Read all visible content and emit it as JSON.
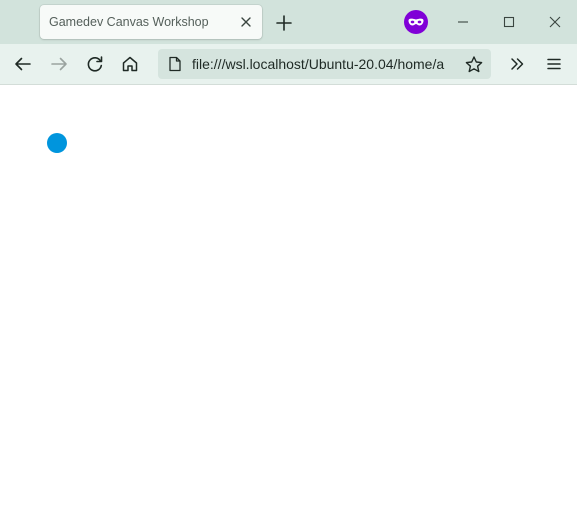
{
  "browser": {
    "tab": {
      "title": "Gamedev Canvas Workshop",
      "close_icon": "close-icon"
    },
    "new_tab_icon": "plus-icon",
    "private_browsing_icon": "private-mask-icon",
    "window_controls": [
      "minimize-icon",
      "maximize-icon",
      "close-icon"
    ],
    "toolbar": {
      "back_icon": "arrow-left-icon",
      "forward_icon": "arrow-right-icon",
      "reload_icon": "reload-icon",
      "home_icon": "home-icon",
      "url": "file:///wsl.localhost/Ubuntu-20.04/home/a",
      "page_icon": "page-icon",
      "bookmark_icon": "star-icon",
      "overflow_icon": "chevrons-right-icon",
      "menu_icon": "hamburger-icon"
    },
    "colors": {
      "tabstrip": "#d2e3dc",
      "toolbar": "#e8f2ee",
      "urlbar": "#d5e4de",
      "private_icon": "#8000d7"
    }
  },
  "page": {
    "canvas": {
      "ball_color": "#0095dd"
    }
  }
}
